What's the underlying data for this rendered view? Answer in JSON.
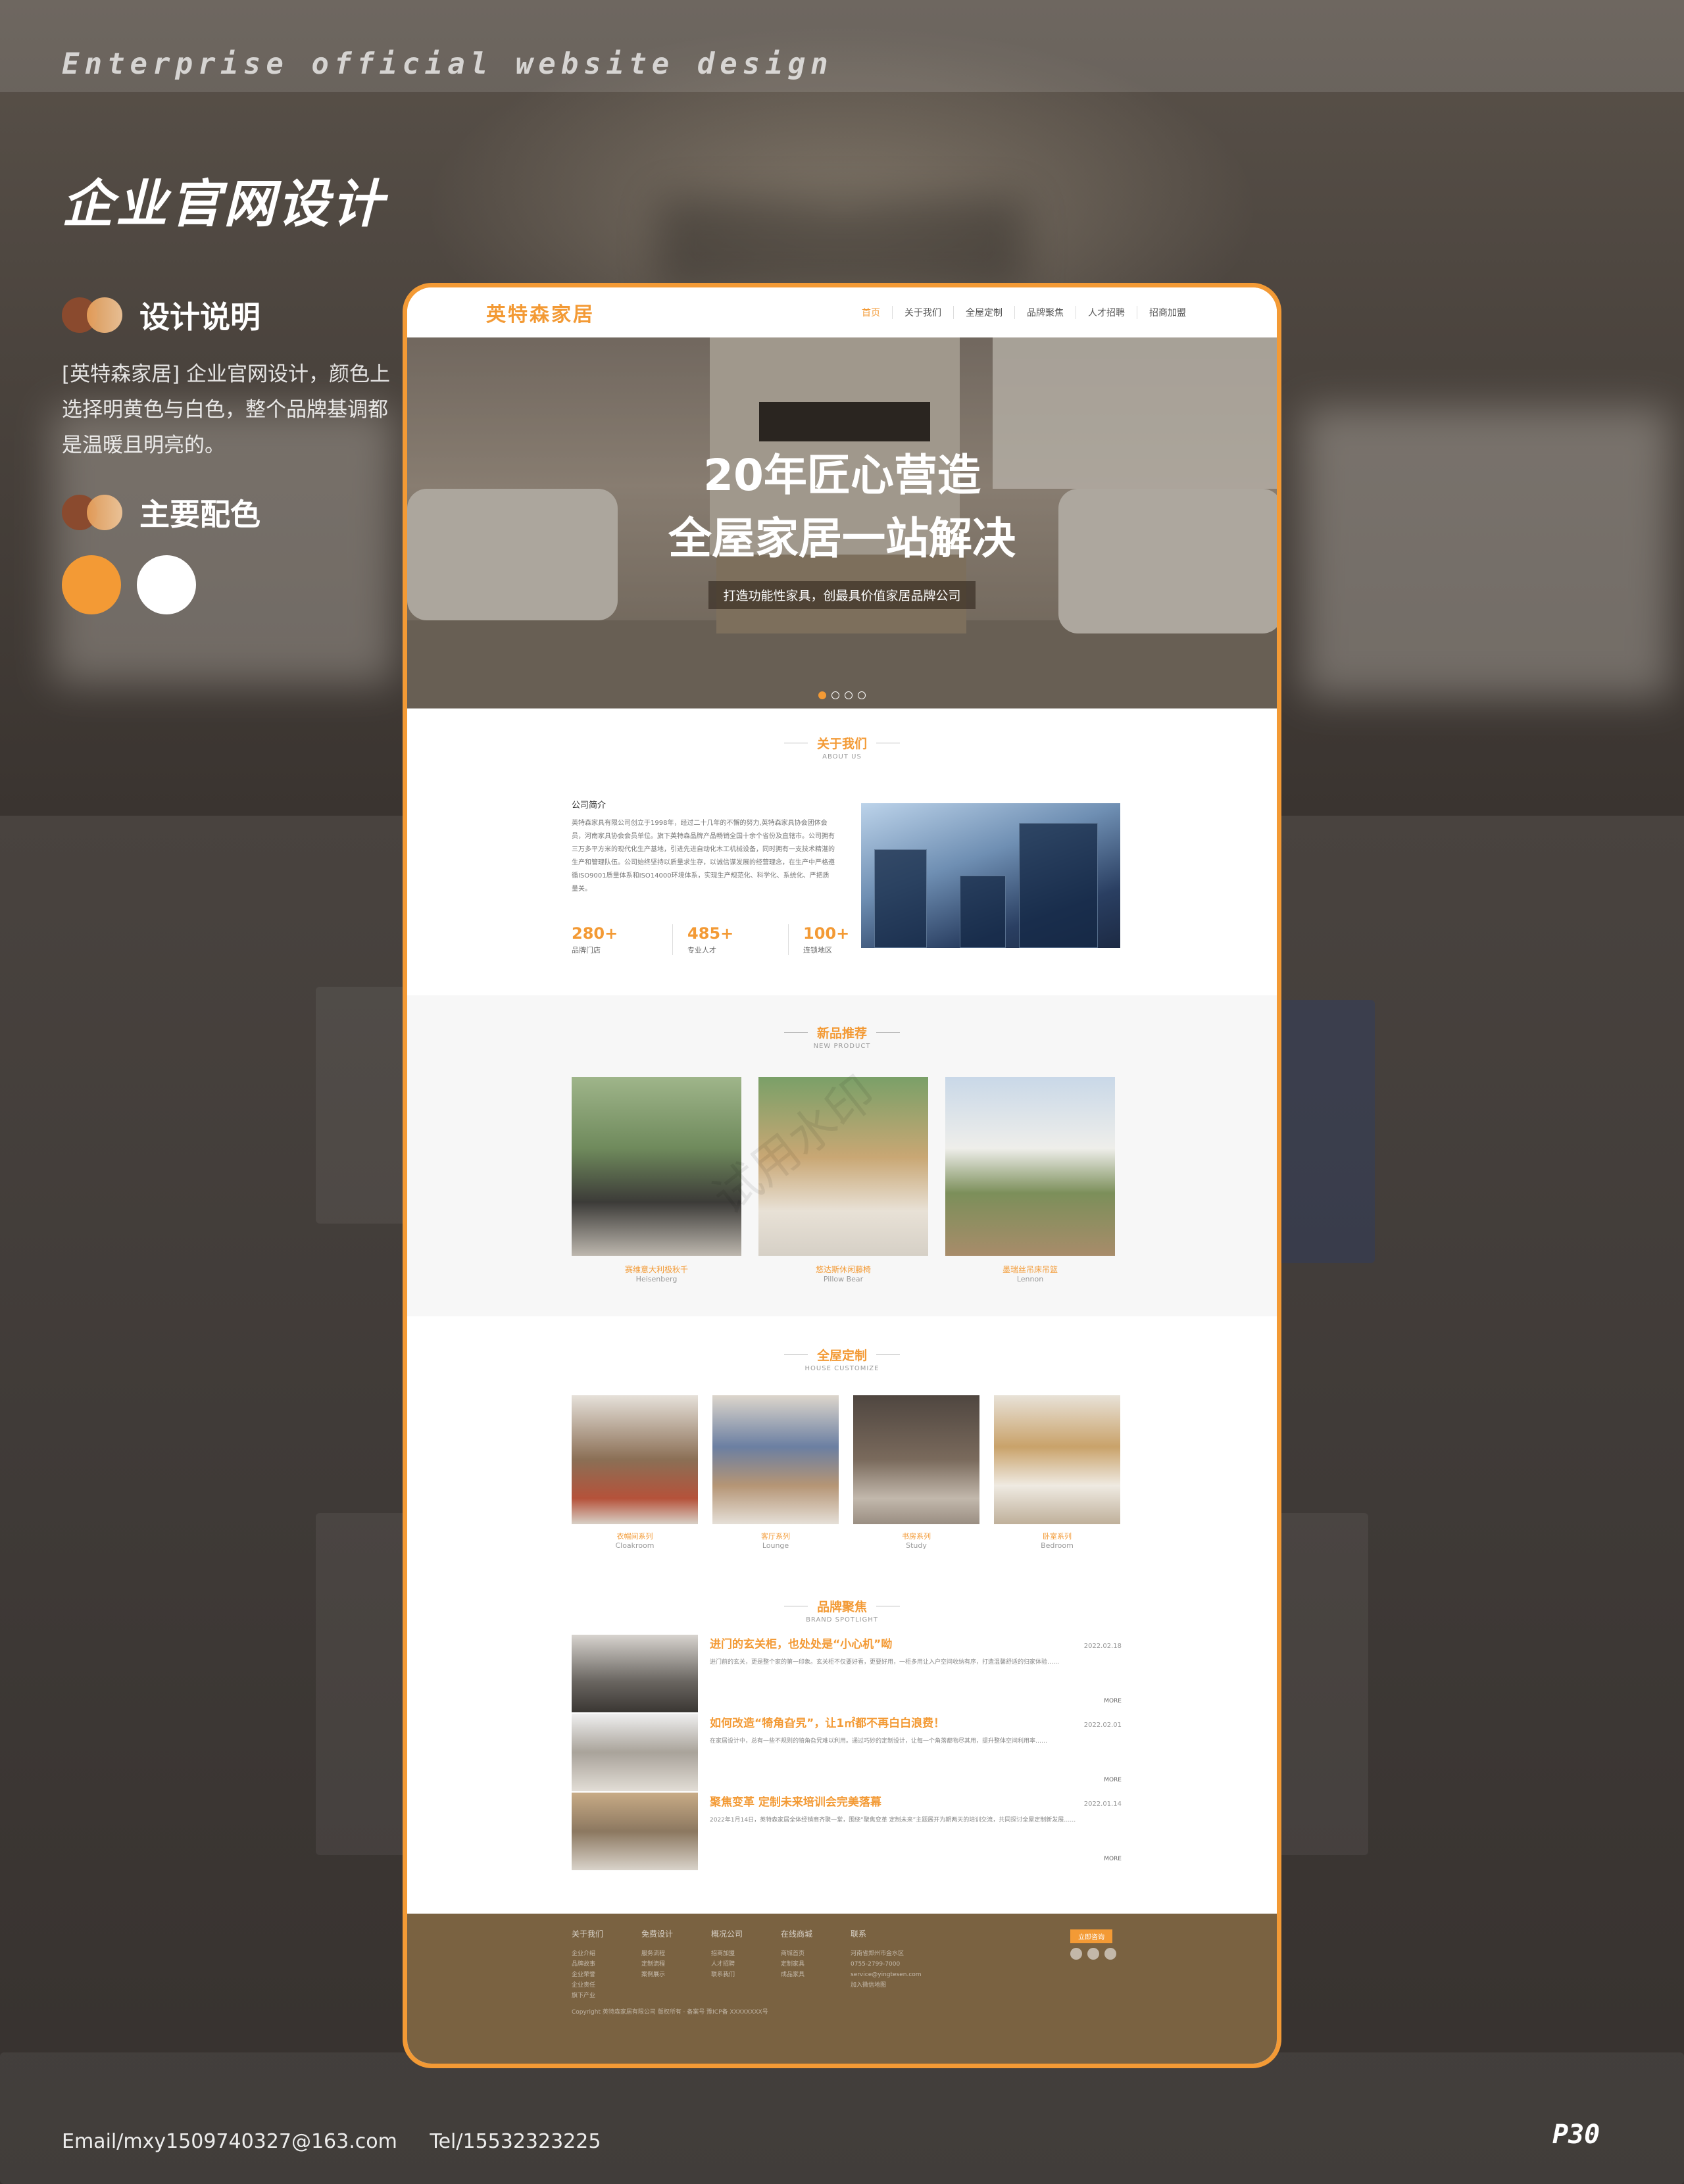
{
  "poster": {
    "en_title": "Enterprise official website design",
    "cn_title": "企业官网设计",
    "sec1_title": "设计说明",
    "description": "[英特森家居] 企业官网设计，颜色上选择明黄色与白色，整个品牌基调都是温暖且明亮的。",
    "sec2_title": "主要配色",
    "colors": [
      "#f39a35",
      "#ffffff"
    ],
    "email": "Email/mxy1509740327@163.com",
    "tel": "Tel/15532323225",
    "page": "P30"
  },
  "site": {
    "logo": "英特森家居",
    "menu": [
      "首页",
      "关于我们",
      "全屋定制",
      "品牌聚焦",
      "人才招聘",
      "招商加盟"
    ],
    "active_menu": "首页",
    "hero": {
      "line1": "20年匠心营造",
      "line2": "全屋家居一站解决",
      "sub": "打造功能性家具，创最具价值家居品牌公司"
    },
    "about": {
      "title": "关于我们",
      "title_en": "ABOUT US",
      "label": "公司简介",
      "text": "英特森家具有限公司创立于1998年，经过二十几年的不懈的努力,英特森家具协会团体会员，河南家具协会会员单位。旗下英特森品牌产品畅销全国十余个省份及直辖市。公司拥有三万多平方米的现代化生产基地，引进先进自动化木工机械设备，同时拥有一支技术精湛的生产和管理队伍。公司始终坚持以质量求生存，以诚信谋发展的经营理念，在生产中严格遵循ISO9001质量体系和ISO14000环境体系，实现生产规范化、科学化、系统化、严把质量关。",
      "stats": [
        {
          "value": "280+",
          "label": "品牌门店"
        },
        {
          "value": "485+",
          "label": "专业人才"
        },
        {
          "value": "100+",
          "label": "连锁地区"
        }
      ]
    },
    "products": {
      "title": "新品推荐",
      "title_en": "NEW PRODUCT",
      "watermark": "试用水印",
      "items": [
        {
          "cn": "赛维意大利极秋千",
          "en": "Heisenberg"
        },
        {
          "cn": "悠达斯休闲藤椅",
          "en": "Pillow Bear"
        },
        {
          "cn": "墨瑞丝吊床吊篮",
          "en": "Lennon"
        }
      ]
    },
    "custom": {
      "title": "全屋定制",
      "title_en": "HOUSE CUSTOMIZE",
      "items": [
        {
          "cn": "衣帽间系列",
          "en": "Cloakroom"
        },
        {
          "cn": "客厅系列",
          "en": "Lounge"
        },
        {
          "cn": "书房系列",
          "en": "Study"
        },
        {
          "cn": "卧室系列",
          "en": "Bedroom"
        }
      ]
    },
    "brand": {
      "title": "品牌聚焦",
      "title_en": "BRAND SPOTLIGHT",
      "news": [
        {
          "title": "进门的玄关柜，也处处是“小心机”呦",
          "date": "2022.02.18",
          "text": "进门前的玄关，更是整个家的第一印象。玄关柜不仅要好看，更要好用，一柜多用让入户空间收纳有序，打造温馨舒适的归家体验……",
          "more": "MORE"
        },
        {
          "title": "如何改造“犄角旮旯”，让1㎡都不再白白浪费！",
          "date": "2022.02.01",
          "text": "在家居设计中，总有一些不规则的犄角旮旯难以利用。通过巧妙的定制设计，让每一个角落都物尽其用，提升整体空间利用率……",
          "more": "MORE"
        },
        {
          "title": "聚焦变革 定制未来培训会完美落幕",
          "date": "2022.01.14",
          "text": "2022年1月14日，英特森家居全体经销商齐聚一堂，围绕“聚焦变革 定制未来”主题展开为期两天的培训交流，共同探讨全屋定制新发展……",
          "more": "MORE"
        }
      ]
    },
    "footer": {
      "cols": [
        {
          "head": "关于我们",
          "items": [
            "企业介绍",
            "品牌故事",
            "企业荣誉",
            "企业责任",
            "旗下产业"
          ]
        },
        {
          "head": "免费设计",
          "items": [
            "服务流程",
            "定制流程",
            "案例展示"
          ]
        },
        {
          "head": "概况公司",
          "items": [
            "招商加盟",
            "人才招聘",
            "联系我们"
          ]
        },
        {
          "head": "在线商城",
          "items": [
            "商城首页",
            "定制家具",
            "成品家具"
          ]
        },
        {
          "head": "联系",
          "items": [
            "河南省郑州市金水区",
            "0755-2799-7000",
            "service@yingtesen.com",
            "加入微信地图"
          ]
        }
      ],
      "button": "立即咨询",
      "copyright": "Copyright 英特森家居有限公司 版权所有 · 备案号 豫ICP备 XXXXXXXX号"
    }
  }
}
